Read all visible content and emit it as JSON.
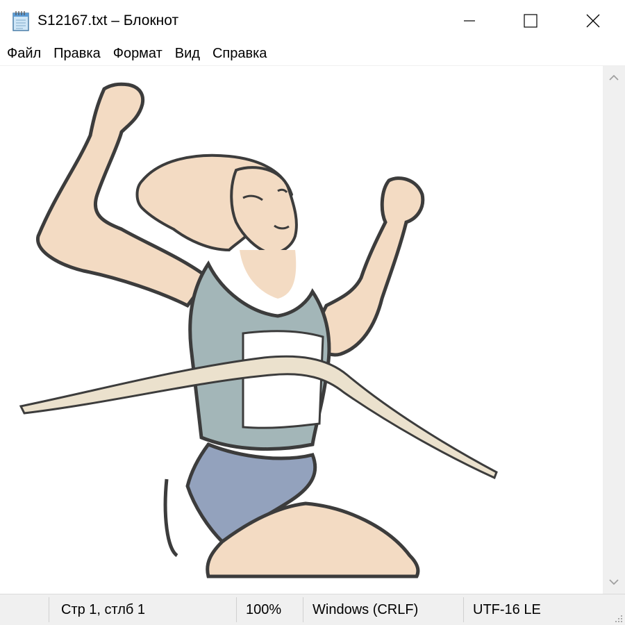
{
  "window": {
    "title": "S12167.txt – Блокнот",
    "icons": {
      "app": "notepad-icon",
      "minimize": "minimize-icon",
      "maximize": "maximize-icon",
      "close": "close-icon"
    }
  },
  "menu": {
    "items": [
      {
        "label": "Файл"
      },
      {
        "label": "Правка"
      },
      {
        "label": "Формат"
      },
      {
        "label": "Вид"
      },
      {
        "label": "Справка"
      }
    ]
  },
  "editor": {
    "content_image": "runner-crossing-finish-line-clipart",
    "colors": {
      "skin": "#f0d3b6",
      "shirt": "#8fa6a8",
      "shorts": "#7b8dae",
      "ribbon": "#e6dbc2",
      "outline": "#111111"
    }
  },
  "scrollbar": {
    "up_icon": "scroll-up-arrow-icon",
    "down_icon": "scroll-down-arrow-icon"
  },
  "status": {
    "position": "Стр 1, стлб 1",
    "zoom": "100%",
    "line_endings": "Windows (CRLF)",
    "encoding": "UTF-16 LE",
    "grip_icon": "resize-grip-icon"
  }
}
